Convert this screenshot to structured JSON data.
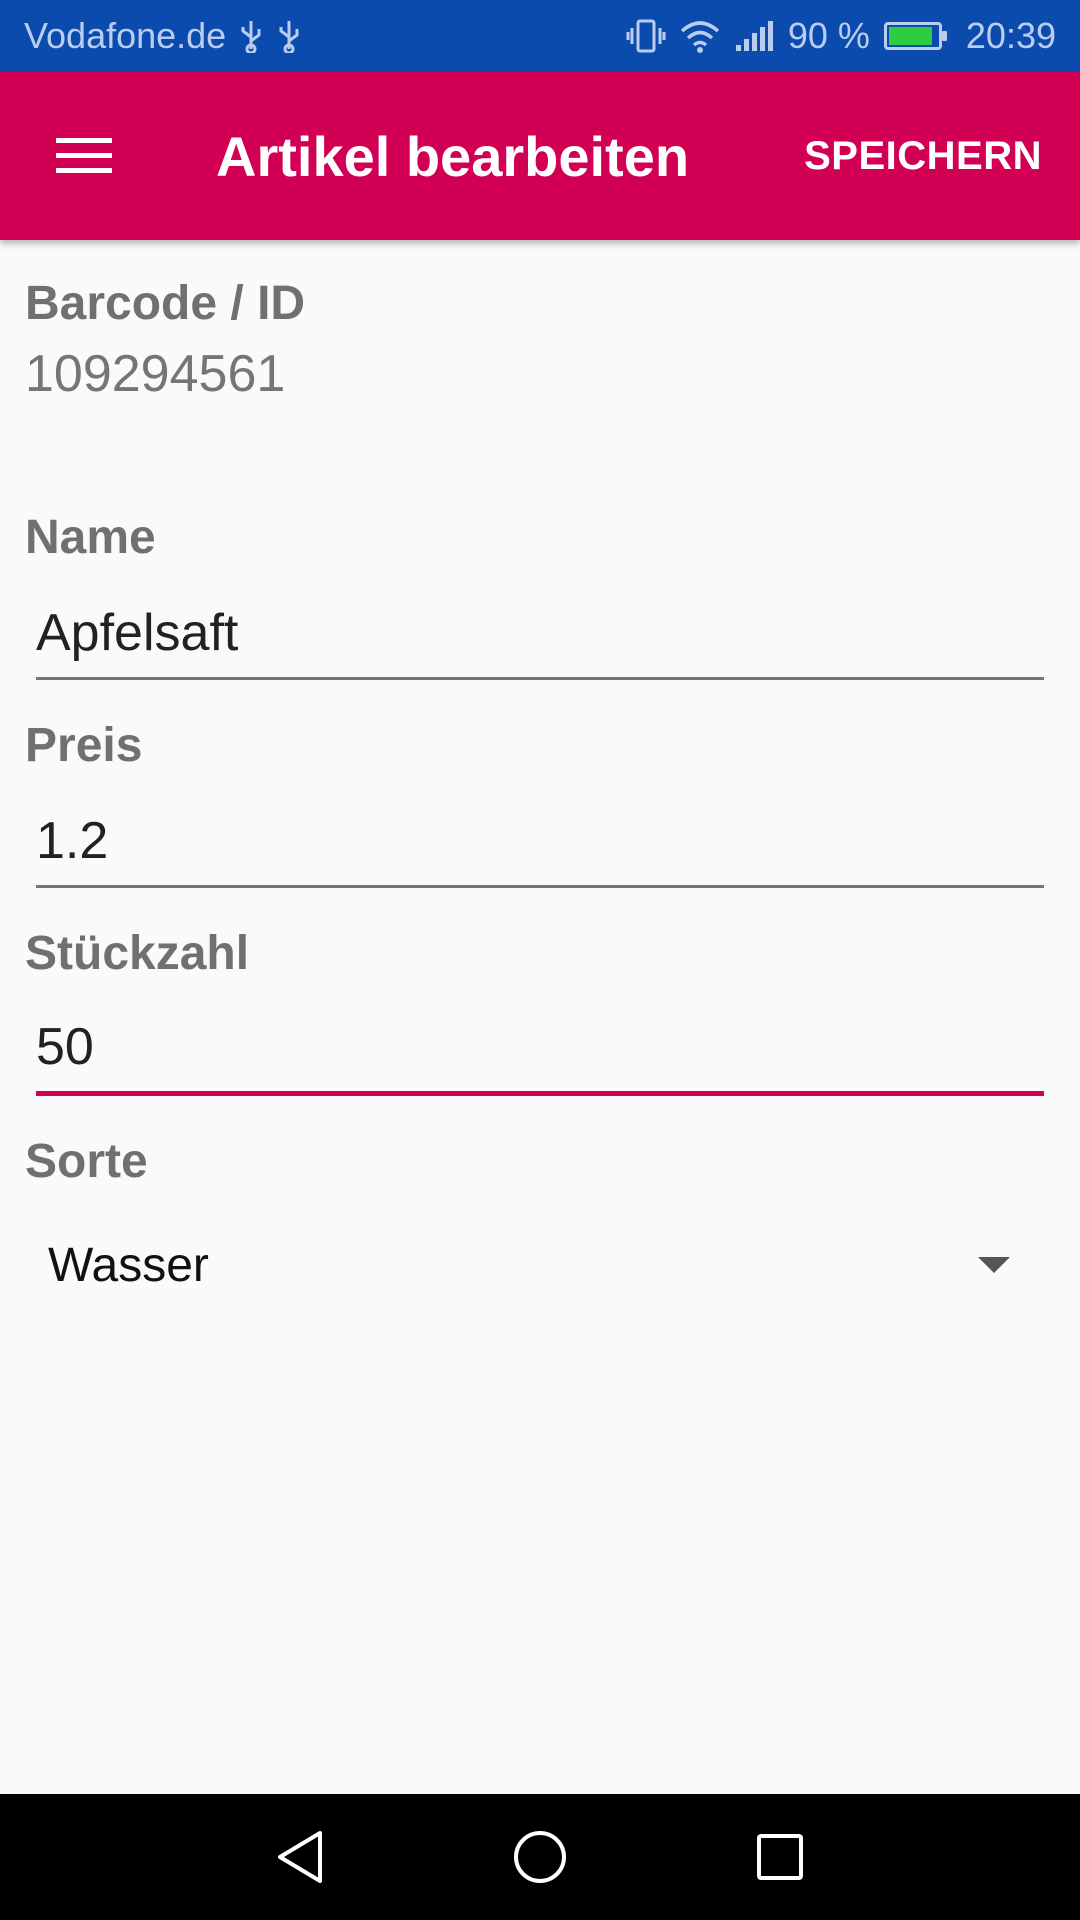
{
  "status_bar": {
    "carrier": "Vodafone.de",
    "battery_percent": "90 %",
    "battery_level": 0.9,
    "time": "20:39",
    "icons": [
      "usb-icon",
      "usb-icon",
      "vibrate-icon",
      "wifi-icon",
      "signal-icon",
      "battery-charging-icon"
    ]
  },
  "app_bar": {
    "menu_icon": "hamburger-menu-icon",
    "title": "Artikel bearbeiten",
    "save_label": "SPEICHERN"
  },
  "form": {
    "barcode": {
      "label": "Barcode / ID",
      "value": "109294561"
    },
    "name": {
      "label": "Name",
      "value": "Apfelsaft"
    },
    "price": {
      "label": "Preis",
      "value": "1.2"
    },
    "quantity": {
      "label": "Stückzahl",
      "value": "50"
    },
    "kind": {
      "label": "Sorte",
      "selected": "Wasser"
    }
  },
  "colors": {
    "status_bar": "#0b4bae",
    "app_bar": "#d10054",
    "accent": "#d10054",
    "background": "#fafafa"
  },
  "nav_bar": {
    "icons": [
      "back-icon",
      "home-icon",
      "recents-icon"
    ]
  }
}
